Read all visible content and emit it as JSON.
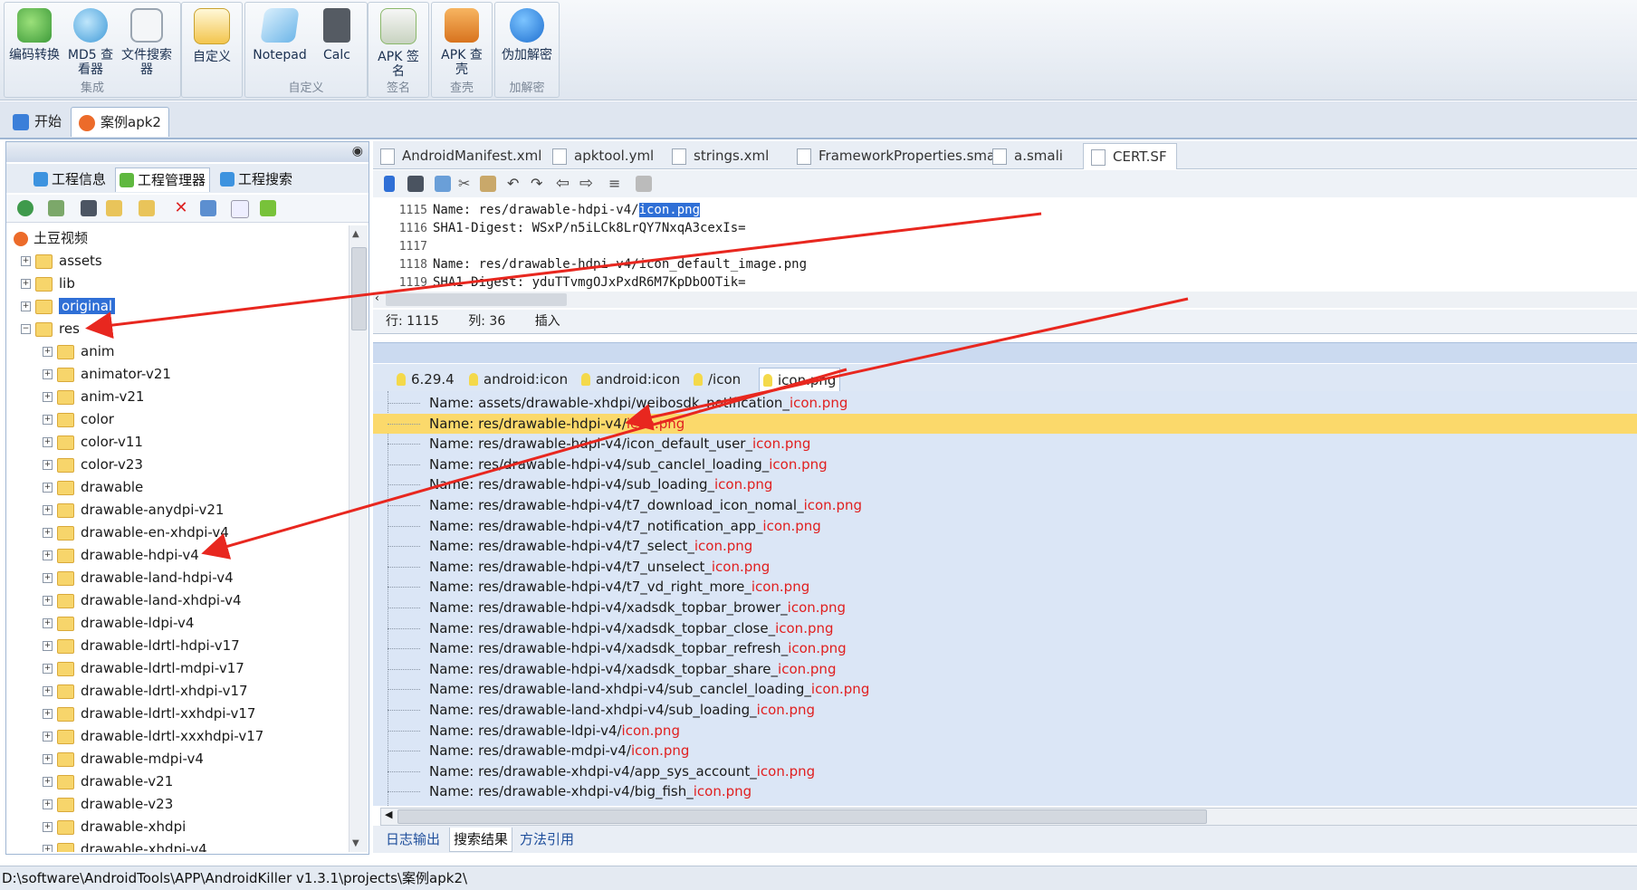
{
  "ribbon": {
    "groups": [
      {
        "label": "集成",
        "buttons": [
          {
            "label": "编码转换",
            "icon": "encode-convert-icon",
            "color": "#4caf50"
          },
          {
            "label": "MD5 查看器",
            "icon": "md5-viewer-icon",
            "color": "#5bb4e8"
          },
          {
            "label": "文件搜索器",
            "icon": "file-search-icon",
            "color": "#9aa5b1"
          }
        ]
      },
      {
        "label": "",
        "buttons": [
          {
            "label": "自定义",
            "icon": "custom-star-icon",
            "color": "#f3c54d"
          }
        ]
      },
      {
        "label": "自定义",
        "buttons": [
          {
            "label": "Notepad",
            "icon": "notepad-icon",
            "color": "#6fb7e9"
          },
          {
            "label": "Calc",
            "icon": "calculator-icon",
            "color": "#555b63"
          }
        ]
      },
      {
        "label": "签名",
        "buttons": [
          {
            "label": "APK 签名",
            "icon": "apk-sign-icon",
            "color": "#8ab86a"
          }
        ]
      },
      {
        "label": "查壳",
        "buttons": [
          {
            "label": "APK 查壳",
            "icon": "apk-shell-check-icon",
            "color": "#e88a2e"
          }
        ]
      },
      {
        "label": "加解密",
        "buttons": [
          {
            "label": "伪加解密",
            "icon": "lock-icon",
            "color": "#2f8de0"
          }
        ]
      }
    ]
  },
  "main_tabs": [
    {
      "label": "开始",
      "icon": "home-icon"
    },
    {
      "label": "案例apk2",
      "icon": "project-icon",
      "active": true
    }
  ],
  "left_panel": {
    "subtabs": [
      {
        "label": "工程信息",
        "icon": "info-icon"
      },
      {
        "label": "工程管理器",
        "icon": "project-manager-icon",
        "active": true
      },
      {
        "label": "工程搜索",
        "icon": "search-icon"
      }
    ],
    "toolbar_icons": [
      "refresh-icon",
      "image-icon",
      "screen-icon",
      "find-folder-icon",
      "folder-icon",
      "delete-icon",
      "compare-icon",
      "file-icon",
      "android-icon"
    ],
    "tree": {
      "root": "土豆视频",
      "top_items": [
        "assets",
        "lib",
        "original",
        "res"
      ],
      "selected": "original",
      "res_children": [
        "anim",
        "animator-v21",
        "anim-v21",
        "color",
        "color-v11",
        "color-v23",
        "drawable",
        "drawable-anydpi-v21",
        "drawable-en-xhdpi-v4",
        "drawable-hdpi-v4",
        "drawable-land-hdpi-v4",
        "drawable-land-xhdpi-v4",
        "drawable-ldpi-v4",
        "drawable-ldrtl-hdpi-v17",
        "drawable-ldrtl-mdpi-v17",
        "drawable-ldrtl-xhdpi-v17",
        "drawable-ldrtl-xxhdpi-v17",
        "drawable-ldrtl-xxxhdpi-v17",
        "drawable-mdpi-v4",
        "drawable-v21",
        "drawable-v23",
        "drawable-xhdpi",
        "drawable-xhdpi-v4"
      ]
    }
  },
  "editor": {
    "tabs": [
      "AndroidManifest.xml",
      "apktool.yml",
      "strings.xml",
      "FrameworkProperties.smali",
      "a.smali",
      "CERT.SF"
    ],
    "active_tab": "CERT.SF",
    "lines": [
      {
        "num": "1115",
        "text": "Name: res/drawable-hdpi-v4/",
        "highlight": "icon.png"
      },
      {
        "num": "1116",
        "text": "SHA1-Digest: WSxP/n5iLCk8LrQY7NxqA3cexIs=",
        "highlight": ""
      },
      {
        "num": "1117",
        "text": "",
        "highlight": ""
      },
      {
        "num": "1118",
        "text": "Name: res/drawable-hdpi-v4/icon_default_image.png",
        "highlight": ""
      },
      {
        "num": "1119",
        "text": "SHA1-Digest: yduTTvmgOJxPxdR6M7KpDbOOTik=",
        "highlight": ""
      }
    ],
    "status": {
      "row": "行: 1115",
      "col": "列: 36",
      "mode": "插入"
    }
  },
  "search": {
    "tabs": [
      "6.29.4",
      "android:icon",
      "android:icon",
      "/icon",
      "icon.png"
    ],
    "active_tab": "icon.png",
    "results": [
      {
        "prefix": "Name: assets/drawable-xhdpi/weibosdk_notification_",
        "hit": "icon.png"
      },
      {
        "prefix": "Name: res/drawable-hdpi-v4/",
        "hit": "icon.png",
        "highlight": true
      },
      {
        "prefix": "Name: res/drawable-hdpi-v4/icon_default_user_",
        "hit": "icon.png"
      },
      {
        "prefix": "Name: res/drawable-hdpi-v4/sub_canclel_loading_",
        "hit": "icon.png"
      },
      {
        "prefix": "Name: res/drawable-hdpi-v4/sub_loading_",
        "hit": "icon.png"
      },
      {
        "prefix": "Name: res/drawable-hdpi-v4/t7_download_icon_nomal_",
        "hit": "icon.png"
      },
      {
        "prefix": "Name: res/drawable-hdpi-v4/t7_notification_app_",
        "hit": "icon.png"
      },
      {
        "prefix": "Name: res/drawable-hdpi-v4/t7_select_",
        "hit": "icon.png"
      },
      {
        "prefix": "Name: res/drawable-hdpi-v4/t7_unselect_",
        "hit": "icon.png"
      },
      {
        "prefix": "Name: res/drawable-hdpi-v4/t7_vd_right_more_",
        "hit": "icon.png"
      },
      {
        "prefix": "Name: res/drawable-hdpi-v4/xadsdk_topbar_brower_",
        "hit": "icon.png"
      },
      {
        "prefix": "Name: res/drawable-hdpi-v4/xadsdk_topbar_close_",
        "hit": "icon.png"
      },
      {
        "prefix": "Name: res/drawable-hdpi-v4/xadsdk_topbar_refresh_",
        "hit": "icon.png"
      },
      {
        "prefix": "Name: res/drawable-hdpi-v4/xadsdk_topbar_share_",
        "hit": "icon.png"
      },
      {
        "prefix": "Name: res/drawable-land-xhdpi-v4/sub_canclel_loading_",
        "hit": "icon.png"
      },
      {
        "prefix": "Name: res/drawable-land-xhdpi-v4/sub_loading_",
        "hit": "icon.png"
      },
      {
        "prefix": "Name: res/drawable-ldpi-v4/",
        "hit": "icon.png"
      },
      {
        "prefix": "Name: res/drawable-mdpi-v4/",
        "hit": "icon.png"
      },
      {
        "prefix": "Name: res/drawable-xhdpi-v4/app_sys_account_",
        "hit": "icon.png"
      },
      {
        "prefix": "Name: res/drawable-xhdpi-v4/big_fish_",
        "hit": "icon.png"
      }
    ]
  },
  "bottom_tabs": [
    "日志输出",
    "搜索结果",
    "方法引用"
  ],
  "bottom_active": "搜索结果",
  "path": "D:\\software\\AndroidTools\\APP\\AndroidKiller v1.3.1\\projects\\案例apk2\\",
  "colors": {
    "accent": "#2f6fd6",
    "highlight_row": "#fbd96b",
    "hit_text": "#e02020",
    "annotation_arrow": "#e8271f"
  }
}
